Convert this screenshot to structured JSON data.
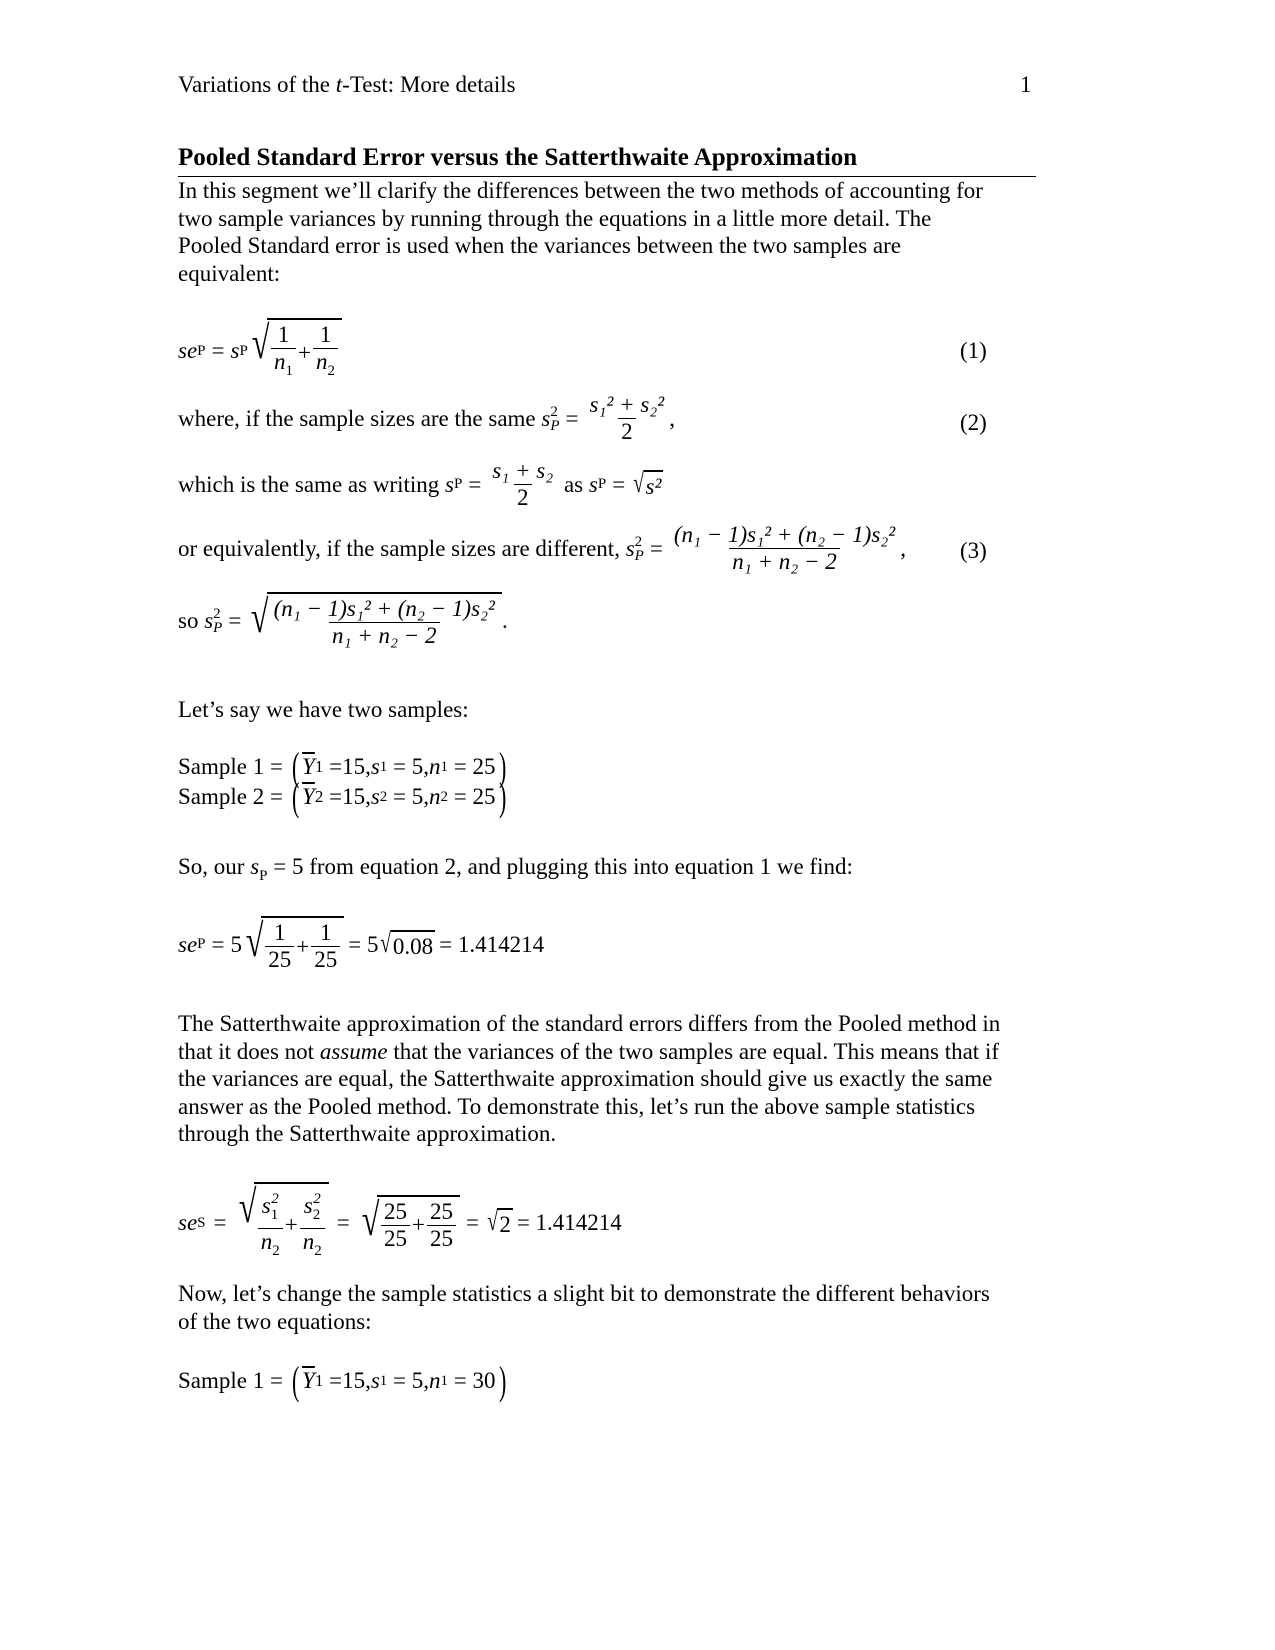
{
  "header": {
    "running_title_pre": "Variations of the ",
    "running_title_t": "t",
    "running_title_post": "-Test: More details",
    "page_number": "1"
  },
  "section": {
    "title": "Pooled Standard Error versus the Satterthwaite Approximation"
  },
  "intro_paragraph": {
    "lines": [
      "In this segment we’ll clarify the differences between the two methods of accounting for",
      "two sample variances by running through the equations in a little more detail.  The",
      "Pooled Standard error is used when the variances between the two samples are",
      "equivalent:"
    ]
  },
  "equations": {
    "eq1": {
      "lhs": "se",
      "lhs_sub": "P",
      "s": "s",
      "s_sub": "P",
      "num": "1",
      "den1": "n",
      "den1_sub": "1",
      "den2": "n",
      "den2_sub": "2",
      "number": "(1)"
    },
    "eq2": {
      "lead": "where, if the sample sizes are the same ",
      "lhs": "s",
      "sub": "P",
      "sup": "2",
      "numerator": "s₁² + s₂²",
      "denominator": "2",
      "number": "(2)"
    },
    "eq2b": {
      "lead": "which is the same as writing ",
      "numerator": "s₁ + s₂",
      "denominator": "2",
      "mid": " as ",
      "rhs": "s",
      "rhs_sub": "P",
      "rad": "s²"
    },
    "eq3": {
      "lead": "or equivalently, if the sample sizes are different, ",
      "numerator": "(n₁ − 1)s₁² + (n₂ − 1)s₂²",
      "denominator": "n₁ + n₂ − 2",
      "number": "(3)"
    },
    "eq3b": {
      "lead": "so ",
      "numerator": "(n₁ − 1)s₁² + (n₂ − 1)s₂²",
      "denominator": "n₁ + n₂ − 2"
    }
  },
  "samples_intro": "Let’s say we have two samples:",
  "samples_a": [
    {
      "label": "Sample 1 = ",
      "ybar": "Y",
      "idx": "1",
      "mean": "15",
      "sd": "5",
      "n": "25"
    },
    {
      "label": "Sample 2 = ",
      "ybar": "Y",
      "idx": "2",
      "mean": "15",
      "sd": "5",
      "n": "25"
    }
  ],
  "pooled_result": {
    "lead_pre": "So, our ",
    "sp_value": "= 5",
    "lead_post": " from equation 2, and plugging this into equation 1 we find:",
    "coef": "5",
    "den": "25",
    "mid": "= 5",
    "rad": "0.08",
    "result": "= 1.414214"
  },
  "satterthwaite_paragraph": {
    "lines": [
      [
        "The Satterthwaite approximation of the standard errors differs from the Pooled method in"
      ],
      [
        "that it does not ",
        "assume",
        " that the variances of the two samples are equal.  This means that if"
      ],
      [
        "the variances are equal, the Satterthwaite approximation should give us exactly the same"
      ],
      [
        "answer as the Pooled method.  To demonstrate this, let’s run the above sample statistics"
      ],
      [
        "through the Satterthwaite approximation."
      ]
    ]
  },
  "satterthwaite_eq": {
    "lhs": "se",
    "lhs_sub": "S",
    "n_sub": "2",
    "val_num": "25",
    "val_den": "25",
    "rad": "2",
    "result": "= 1.414214"
  },
  "change_paragraph": {
    "lines": [
      "Now, let’s change the sample statistics a slight bit to demonstrate the different behaviors",
      "of the two equations:"
    ]
  },
  "samples_b": [
    {
      "label": "Sample 1 = ",
      "ybar": "Y",
      "idx": "1",
      "mean": "15",
      "sd": "5",
      "n": "30"
    }
  ]
}
